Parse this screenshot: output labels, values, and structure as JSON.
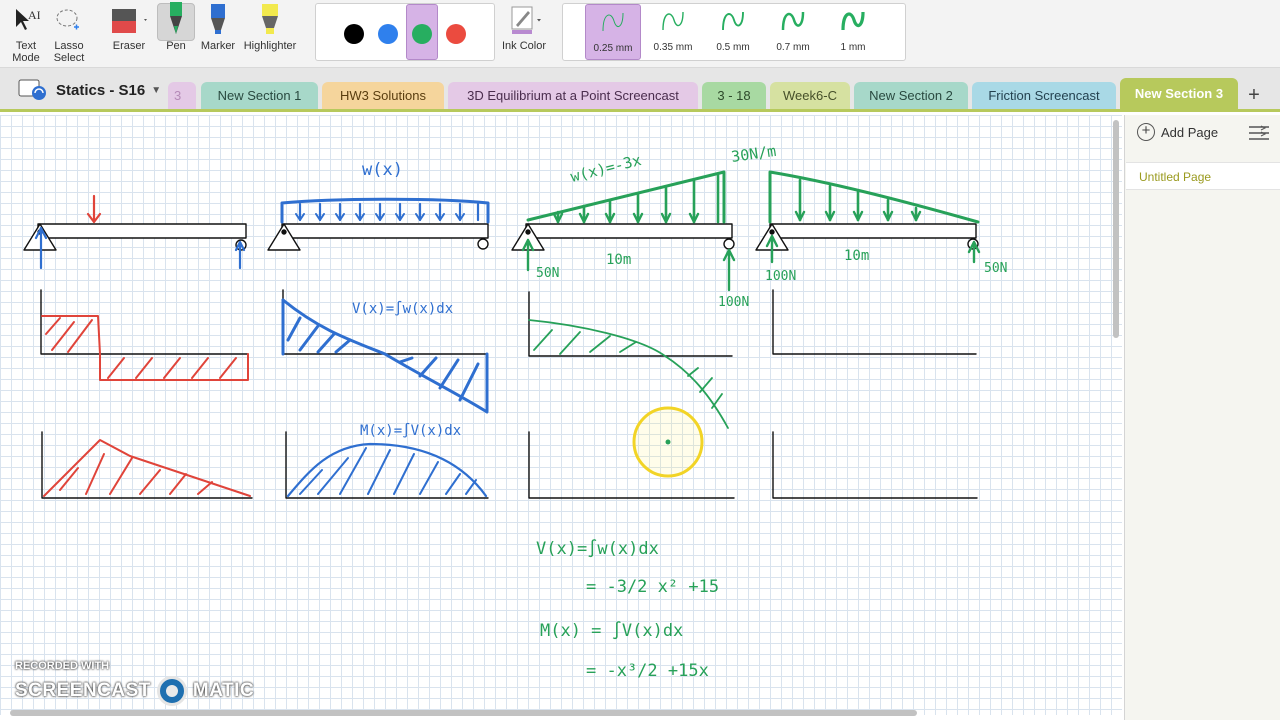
{
  "toolbar": {
    "text_mode_label": "Text\nMode",
    "text_mode_line1": "Text",
    "text_mode_line2": "Mode",
    "lasso_line1": "Lasso",
    "lasso_line2": "Select",
    "eraser_label": "Eraser",
    "pen_label": "Pen",
    "marker_label": "Marker",
    "highlighter_label": "Highlighter",
    "ink_color_label": "Ink Color",
    "colors": [
      "#000000",
      "#2f80ed",
      "#27ae60",
      "#eb4b3f"
    ],
    "selected_color": "#27ae60",
    "stroke_widths": [
      "0.25 mm",
      "0.35 mm",
      "0.5 mm",
      "0.7 mm",
      "1 mm"
    ],
    "selected_stroke": "0.25 mm"
  },
  "notebook": {
    "title": "Statics - S16",
    "partial_tab": "3"
  },
  "tabs": [
    {
      "label": "New Section 1",
      "color": "#a7d8c9",
      "text": "#2a4a40"
    },
    {
      "label": "HW3 Solutions",
      "color": "#f5d59c",
      "text": "#5a3e10"
    },
    {
      "label": "3D Equilibrium at a Point Screencast",
      "color": "#e4c9e6",
      "text": "#4a2d4d"
    },
    {
      "label": "3 - 18",
      "color": "#a8d9a2",
      "text": "#2e4a2b"
    },
    {
      "label": "Week6-C",
      "color": "#d6e1a1",
      "text": "#46502a"
    },
    {
      "label": "New Section 2",
      "color": "#a7d8c9",
      "text": "#2a4a40"
    },
    {
      "label": "Friction Screencast",
      "color": "#a9d9e6",
      "text": "#244250"
    },
    {
      "label": "New Section 3",
      "color": "#b7c95c",
      "text": "#ffffff",
      "active": true
    }
  ],
  "panel": {
    "add_page": "Add Page",
    "pages": [
      "Untitled Page"
    ]
  },
  "handwriting": {
    "wx": "w(x)",
    "wx_eq": "w(x)=-3x",
    "load_max": "30N/m",
    "len1": "10m",
    "len2": "10m",
    "r50a": "50N",
    "r100a": "100N",
    "r100b": "100N",
    "r50b": "50N",
    "v_int": "V(x)=∫w(x)dx",
    "m_int": "M(x)=∫V(x)dx",
    "eq1": "V(x)=∫w(x)dx",
    "eq2": "= -3/2 x² +15",
    "eq3": "M(x) = ∫V(x)dx",
    "eq4": "= -x³/2 +15x"
  },
  "watermark": {
    "line1": "RECORDED WITH",
    "left": "SCREENCAST",
    "right": "MATIC"
  }
}
